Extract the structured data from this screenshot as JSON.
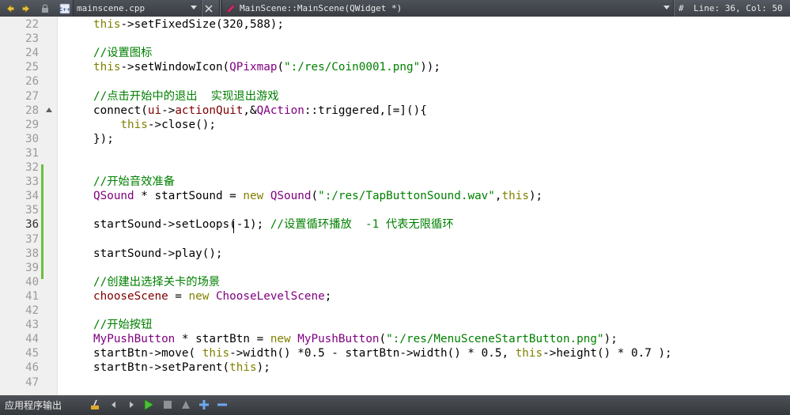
{
  "toolbar": {
    "file_name": "mainscene.cpp",
    "symbol": "MainScene::MainScene(QWidget *)",
    "hash": "#",
    "position": "Line: 36, Col: 50"
  },
  "editor": {
    "lines": [
      {
        "n": "22",
        "tokens": [
          [
            "kw",
            "this"
          ],
          [
            "",
            "->setFixedSize(320,588);"
          ]
        ]
      },
      {
        "n": "23",
        "tokens": []
      },
      {
        "n": "24",
        "tokens": [
          [
            "cm",
            "//设置图标"
          ]
        ]
      },
      {
        "n": "25",
        "tokens": [
          [
            "kw",
            "this"
          ],
          [
            "",
            "->setWindowIcon("
          ],
          [
            "ty",
            "QPixmap"
          ],
          [
            "",
            "("
          ],
          [
            "str",
            "\":/res/Coin0001.png\""
          ],
          [
            "",
            "));"
          ]
        ]
      },
      {
        "n": "26",
        "tokens": []
      },
      {
        "n": "27",
        "tokens": [
          [
            "cm",
            "//点击开始中的退出  实现退出游戏"
          ]
        ]
      },
      {
        "n": "28",
        "fold": true,
        "tokens": [
          [
            "",
            "connect("
          ],
          [
            "mem",
            "ui"
          ],
          [
            "",
            "->"
          ],
          [
            "mem",
            "actionQuit"
          ],
          [
            "",
            ",&"
          ],
          [
            "ty",
            "QAction"
          ],
          [
            "",
            "::triggered,[=](){"
          ]
        ]
      },
      {
        "n": "29",
        "tokens": [
          [
            "",
            "    "
          ],
          [
            "kw",
            "this"
          ],
          [
            "",
            "->close();"
          ]
        ]
      },
      {
        "n": "30",
        "tokens": [
          [
            "",
            "});"
          ]
        ]
      },
      {
        "n": "31",
        "tokens": []
      },
      {
        "n": "32",
        "tokens": []
      },
      {
        "n": "33",
        "tokens": [
          [
            "cm",
            "//开始音效准备"
          ]
        ]
      },
      {
        "n": "34",
        "tokens": [
          [
            "ty",
            "QSound"
          ],
          [
            "",
            " * startSound = "
          ],
          [
            "kw",
            "new"
          ],
          [
            "",
            " "
          ],
          [
            "ty",
            "QSound"
          ],
          [
            "",
            "("
          ],
          [
            "str",
            "\":/res/TapButtonSound.wav\""
          ],
          [
            "",
            ","
          ],
          [
            "kw",
            "this"
          ],
          [
            "",
            ");"
          ]
        ]
      },
      {
        "n": "35",
        "tokens": []
      },
      {
        "n": "36",
        "current": true,
        "tokens": [
          [
            "",
            "startSound->setLoops(-1); "
          ],
          [
            "cm",
            "//设置循环播放  -1 代表无限循环"
          ]
        ]
      },
      {
        "n": "37",
        "tokens": []
      },
      {
        "n": "38",
        "tokens": [
          [
            "",
            "startSound->play();"
          ]
        ]
      },
      {
        "n": "39",
        "tokens": []
      },
      {
        "n": "40",
        "tokens": [
          [
            "cm",
            "//创建出选择关卡的场景"
          ]
        ]
      },
      {
        "n": "41",
        "tokens": [
          [
            "mem",
            "chooseScene"
          ],
          [
            "",
            " = "
          ],
          [
            "kw",
            "new"
          ],
          [
            "",
            " "
          ],
          [
            "ty",
            "ChooseLevelScene"
          ],
          [
            "",
            ";"
          ]
        ]
      },
      {
        "n": "42",
        "tokens": []
      },
      {
        "n": "43",
        "tokens": [
          [
            "cm",
            "//开始按钮"
          ]
        ]
      },
      {
        "n": "44",
        "tokens": [
          [
            "ty",
            "MyPushButton"
          ],
          [
            "",
            " * startBtn = "
          ],
          [
            "kw",
            "new"
          ],
          [
            "",
            " "
          ],
          [
            "ty",
            "MyPushButton"
          ],
          [
            "",
            "("
          ],
          [
            "str",
            "\":/res/MenuSceneStartButton.png\""
          ],
          [
            "",
            ");"
          ]
        ]
      },
      {
        "n": "45",
        "tokens": [
          [
            "",
            "startBtn->move( "
          ],
          [
            "kw",
            "this"
          ],
          [
            "",
            "->width() *0.5 - startBtn->width() * 0.5, "
          ],
          [
            "kw",
            "this"
          ],
          [
            "",
            "->height() * 0.7 );"
          ]
        ]
      },
      {
        "n": "46",
        "tokens": [
          [
            "",
            "startBtn->setParent("
          ],
          [
            "kw",
            "this"
          ],
          [
            "",
            ");"
          ]
        ]
      },
      {
        "n": "47",
        "tokens": []
      }
    ]
  },
  "bottom": {
    "label": "应用程序输出"
  }
}
